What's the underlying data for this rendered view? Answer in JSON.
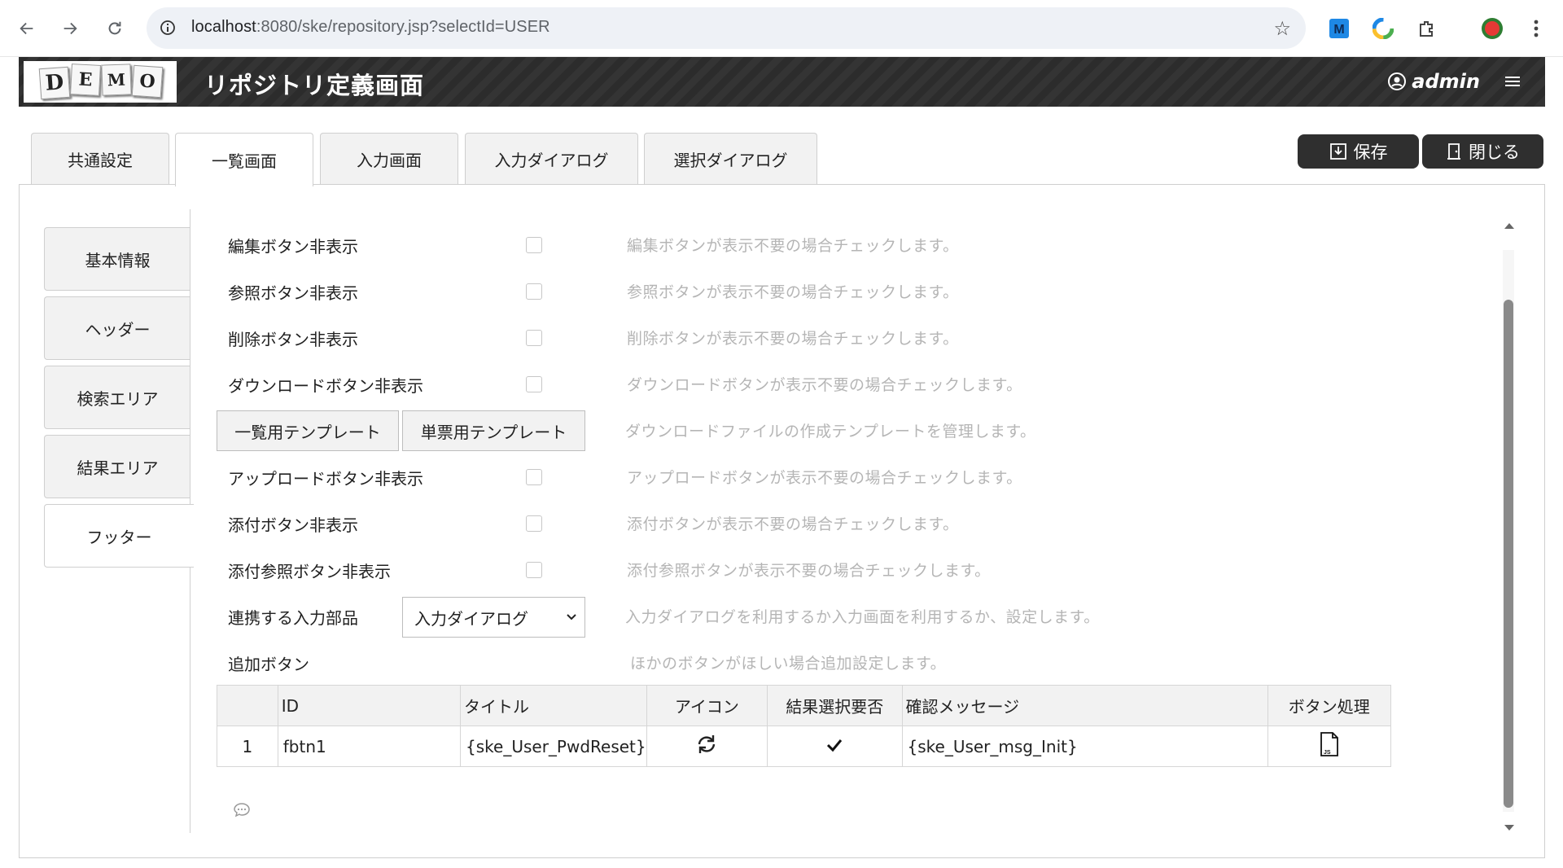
{
  "browser": {
    "url_host": "localhost",
    "url_path": ":8080/ske/repository.jsp?selectId=USER"
  },
  "header": {
    "logo_letters": [
      "D",
      "E",
      "M",
      "O"
    ],
    "title": "リポジトリ定義画面",
    "user": "admin"
  },
  "tabs": [
    {
      "label": "共通設定"
    },
    {
      "label": "一覧画面"
    },
    {
      "label": "入力画面"
    },
    {
      "label": "入力ダイアログ"
    },
    {
      "label": "選択ダイアログ"
    }
  ],
  "actions": {
    "save_label": "保存",
    "close_label": "閉じる"
  },
  "side_tabs": [
    {
      "label": "基本情報"
    },
    {
      "label": "ヘッダー"
    },
    {
      "label": "検索エリア"
    },
    {
      "label": "結果エリア"
    },
    {
      "label": "フッター"
    }
  ],
  "rows": {
    "edit_hide": {
      "label": "編集ボタン非表示",
      "desc": "編集ボタンが表示不要の場合チェックします。"
    },
    "ref_hide": {
      "label": "参照ボタン非表示",
      "desc": "参照ボタンが表示不要の場合チェックします。"
    },
    "del_hide": {
      "label": "削除ボタン非表示",
      "desc": "削除ボタンが表示不要の場合チェックします。"
    },
    "dl_hide": {
      "label": "ダウンロードボタン非表示",
      "desc": "ダウンロードボタンが表示不要の場合チェックします。"
    },
    "templates": {
      "list_btn": "一覧用テンプレート",
      "single_btn": "単票用テンプレート",
      "desc": "ダウンロードファイルの作成テンプレートを管理します。"
    },
    "ul_hide": {
      "label": "アップロードボタン非表示",
      "desc": "アップロードボタンが表示不要の場合チェックします。"
    },
    "att_hide": {
      "label": "添付ボタン非表示",
      "desc": "添付ボタンが表示不要の場合チェックします。"
    },
    "attref_hide": {
      "label": "添付参照ボタン非表示",
      "desc": "添付参照ボタンが表示不要の場合チェックします。"
    },
    "input_part": {
      "label": "連携する入力部品",
      "value": "入力ダイアログ",
      "desc": "入力ダイアログを利用するか入力画面を利用するか、設定します。"
    },
    "add_btn": {
      "label": "追加ボタン",
      "desc": "ほかのボタンがほしい場合追加設定します。"
    }
  },
  "table": {
    "headers": [
      "",
      "ID",
      "タイトル",
      "アイコン",
      "結果選択要否",
      "確認メッセージ",
      "ボタン処理"
    ],
    "rows": [
      {
        "no": "1",
        "id": "fbtn1",
        "title": "{ske_User_PwdReset}",
        "message": "{ske_User_msg_Init}"
      }
    ]
  }
}
